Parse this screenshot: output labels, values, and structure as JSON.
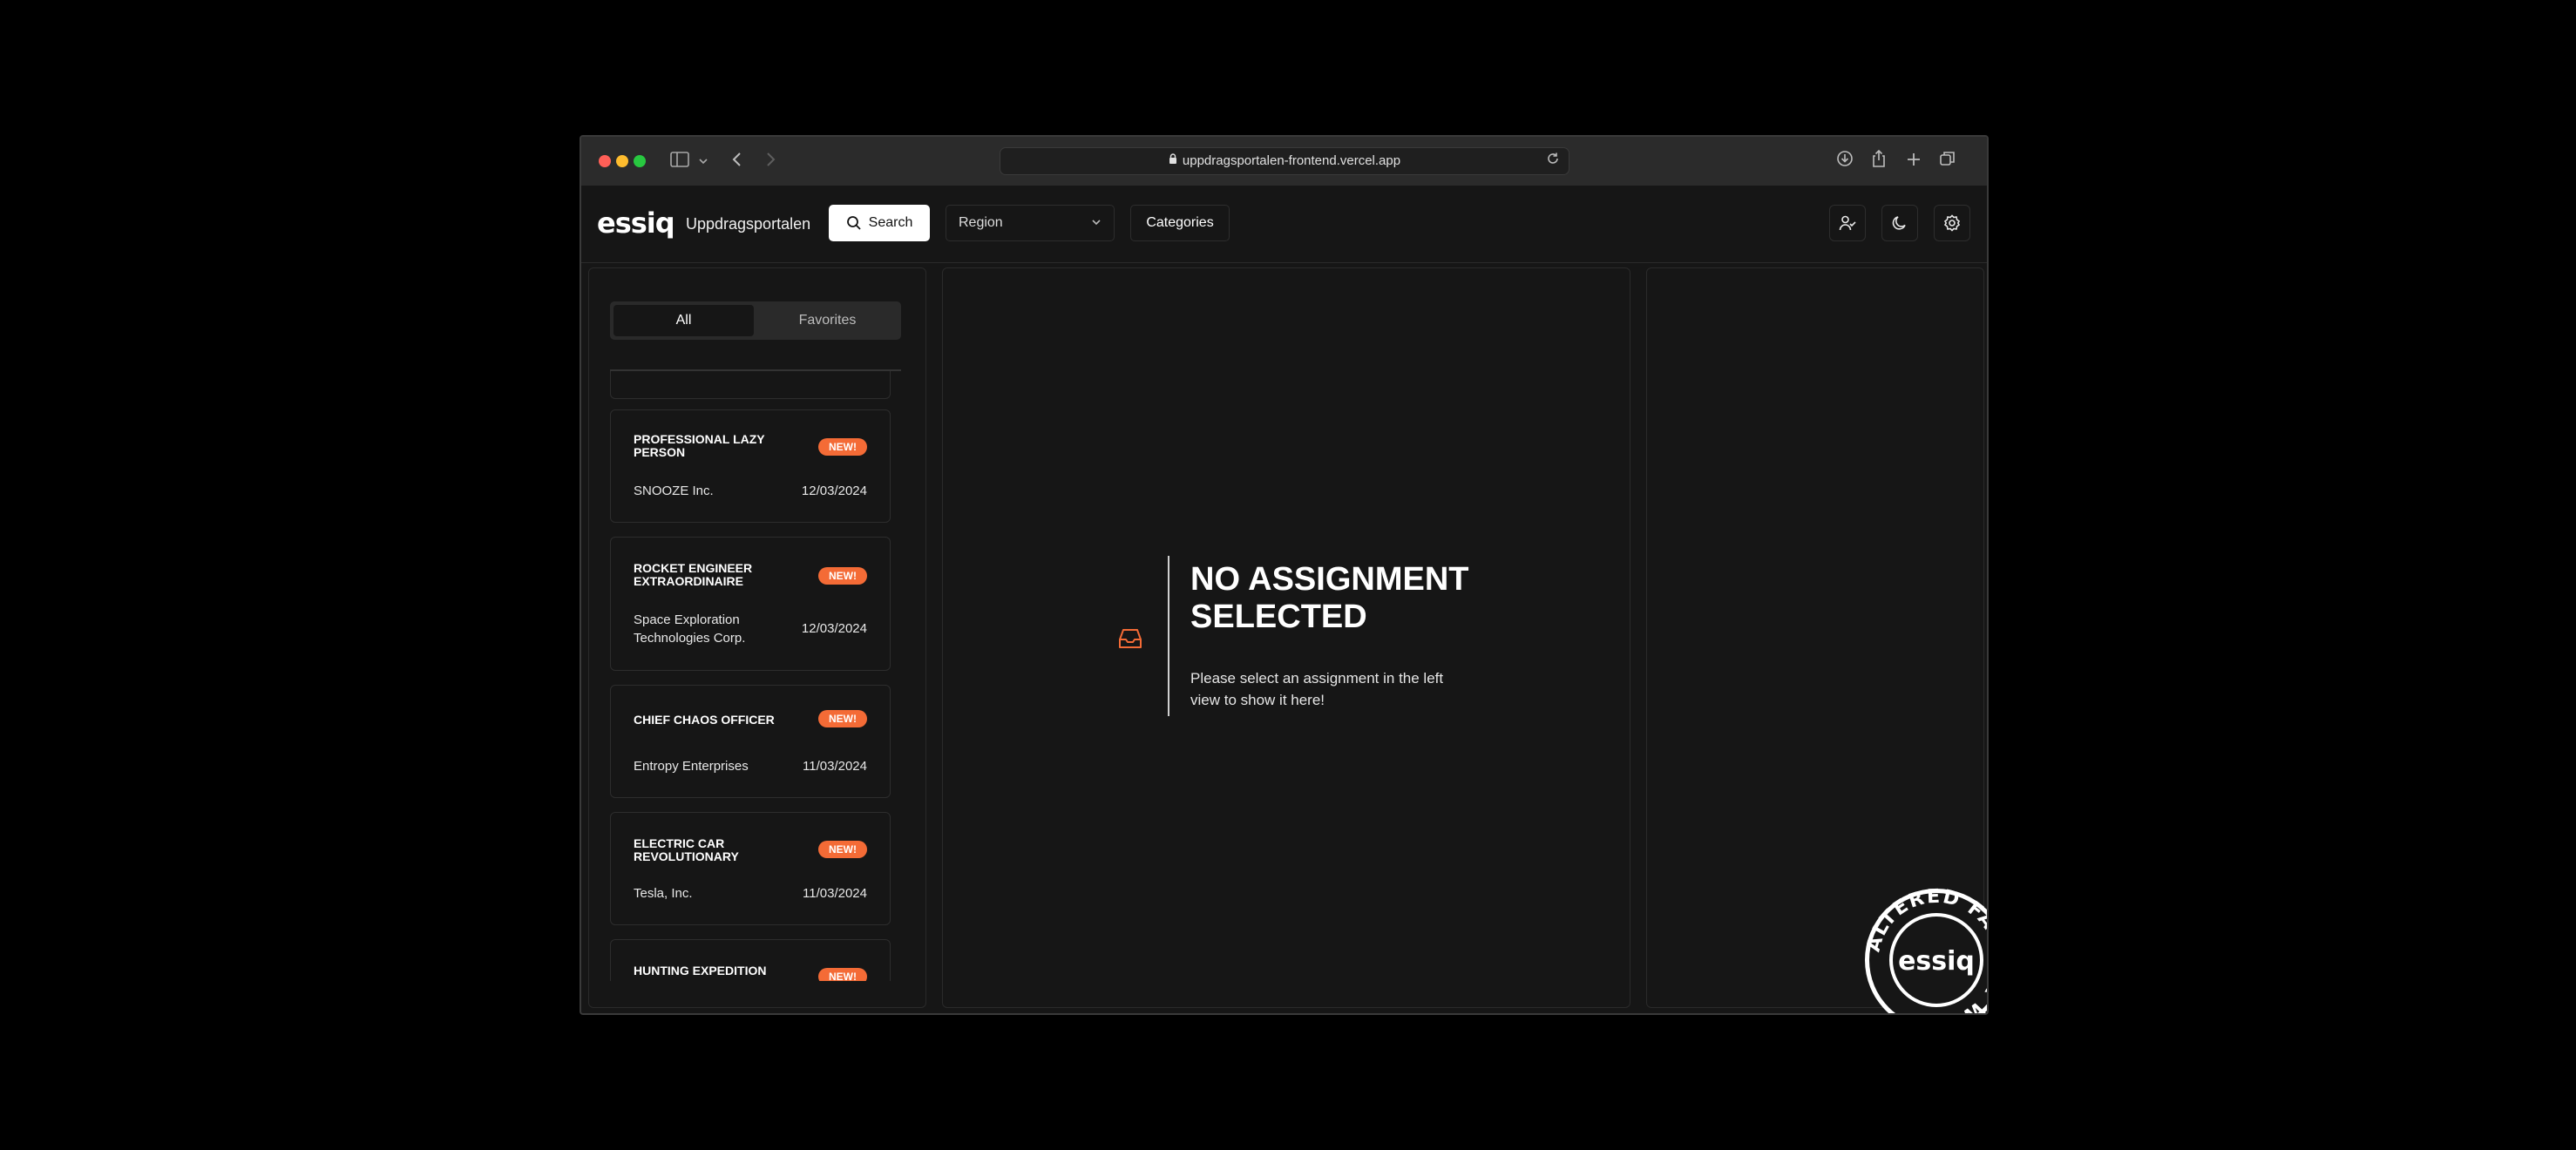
{
  "browser": {
    "url": "uppdragsportalen-frontend.vercel.app"
  },
  "header": {
    "logo": "essiq",
    "app_name": "Uppdragsportalen",
    "search_label": "Search",
    "region_label": "Region",
    "categories_label": "Categories"
  },
  "sidebar": {
    "tabs": {
      "all": "All",
      "favorites": "Favorites"
    },
    "badge_label": "NEW!",
    "assignments": [
      {
        "title": "PROFESSIONAL LAZY PERSON",
        "company": "SNOOZE Inc.",
        "date": "12/03/2024"
      },
      {
        "title": "ROCKET ENGINEER EXTRAORDINAIRE",
        "company": "Space Exploration Technologies Corp.",
        "date": "12/03/2024"
      },
      {
        "title": "CHIEF CHAOS OFFICER",
        "company": "Entropy Enterprises",
        "date": "11/03/2024"
      },
      {
        "title": "ELECTRIC CAR REVOLUTIONARY",
        "company": "Tesla, Inc.",
        "date": "11/03/2024"
      },
      {
        "title": "HUNTING EXPEDITION"
      }
    ]
  },
  "main": {
    "empty_title": "NO ASSIGNMENT SELECTED",
    "empty_description": "Please select an assignment in the left view to show it here!"
  },
  "stamp": {
    "text": "ALTERED FACTOR WE",
    "logo": "essiq"
  },
  "colors": {
    "accent": "#f46b36",
    "background": "#161616",
    "border": "#2d2d2d"
  },
  "icons": {
    "search": "search-icon",
    "user": "user-check-icon",
    "theme": "moon-icon",
    "settings": "settings-icon",
    "empty": "inbox-icon"
  }
}
